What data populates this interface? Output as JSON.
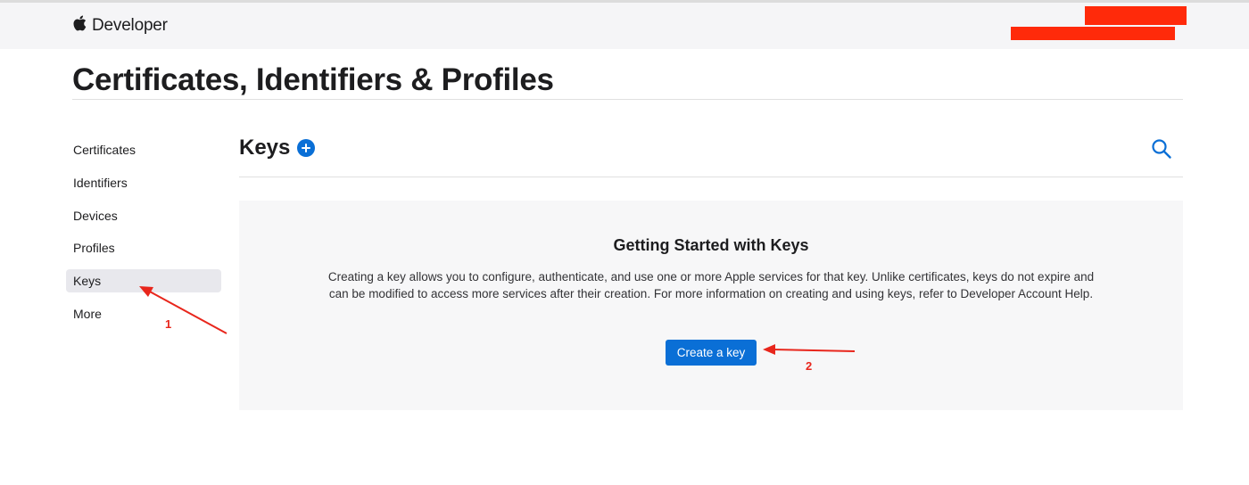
{
  "header": {
    "brand": "Developer",
    "logo_icon": "apple-logo-icon"
  },
  "page": {
    "title": "Certificates, Identifiers & Profiles"
  },
  "sidebar": {
    "items": [
      {
        "label": "Certificates",
        "active": false
      },
      {
        "label": "Identifiers",
        "active": false
      },
      {
        "label": "Devices",
        "active": false
      },
      {
        "label": "Profiles",
        "active": false
      },
      {
        "label": "Keys",
        "active": true
      },
      {
        "label": "More",
        "active": false
      }
    ]
  },
  "main": {
    "section_title": "Keys",
    "add_icon": "plus-circle-icon",
    "search_icon": "search-icon",
    "empty_state": {
      "title": "Getting Started with Keys",
      "description": "Creating a key allows you to configure, authenticate, and use one or more Apple services for that key. Unlike certificates, keys do not expire and can be modified to access more services after their creation. For more information on creating and using keys, refer to Developer Account Help.",
      "button_label": "Create a key"
    }
  },
  "annotations": {
    "step1": "1",
    "step2": "2",
    "color": "#e8261c"
  },
  "colors": {
    "accent": "#0a6fd6",
    "redaction": "#ff2a0a"
  }
}
